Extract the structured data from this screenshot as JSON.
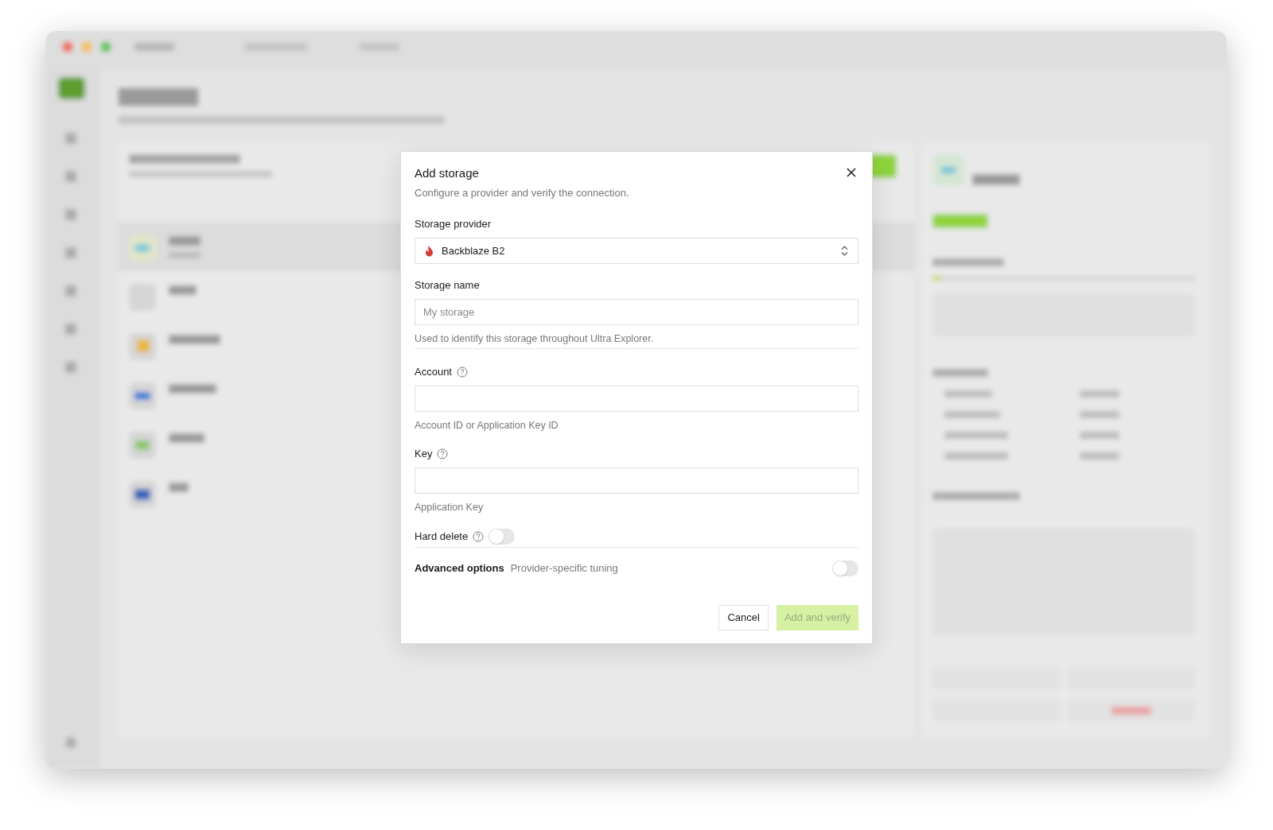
{
  "dialog": {
    "title": "Add storage",
    "subtitle": "Configure a provider and verify the connection.",
    "fields": [
      {
        "kind": "select",
        "label": "Storage provider",
        "value": "Backblaze B2"
      },
      {
        "kind": "text",
        "label": "Storage name",
        "placeholder": "My storage",
        "help": "Used to identify this storage throughout Ultra Explorer.",
        "divider": true
      },
      {
        "kind": "text",
        "label": "Account",
        "info": true,
        "help": "Account ID or Application Key ID"
      },
      {
        "kind": "text",
        "label": "Key",
        "info": true,
        "help": "Application Key"
      },
      {
        "kind": "toggle",
        "label": "Hard delete",
        "info": true,
        "on": false
      }
    ],
    "advanced": {
      "label": "Advanced options",
      "description": "Provider-specific tuning",
      "on": false
    },
    "buttons": [
      {
        "label": "Cancel",
        "primary": false,
        "disabled": false
      },
      {
        "label": "Add and verify",
        "primary": true,
        "disabled": true
      }
    ]
  }
}
